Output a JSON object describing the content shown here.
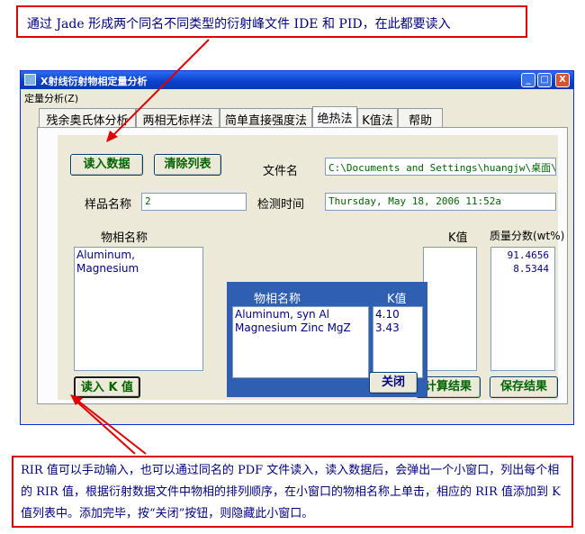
{
  "callout_top": "通过 Jade 形成两个同名不同类型的衍射峰文件 IDE 和 PID，在此都要读入",
  "callout_bottom": "RIR 值可以手动输入，也可以通过同名的 PDF 文件读入，读入数据后，会弹出一个小窗口，列出每个相的 RIR 值，根据衍射数据文件中物相的排列顺序，在小窗口的物相名称上单击，相应的 RIR 值添加到 K 值列表中。添加完毕，按“关闭”按钮，则隐藏此小窗口。",
  "window": {
    "title": "X射线衍射物相定量分析",
    "menu": [
      "定量分析(Z)"
    ],
    "controls": {
      "minimize": "_",
      "maximize": "□",
      "close": "X"
    }
  },
  "tabs": [
    "残余奥氏体分析",
    "两相无标样法",
    "简单直接强度法",
    "绝热法",
    "K值法",
    "帮助"
  ],
  "active_tab": "绝热法",
  "panel": {
    "read_data_button": "读入数据",
    "clear_list_button": "清除列表",
    "filename_label": "文件名",
    "filename_value": "C:\\Documents and Settings\\huangjw\\桌面\\:",
    "sample_name_label": "样品名称",
    "sample_name_value": "2",
    "detect_time_label": "检测时间",
    "detect_time_value": "Thursday, May 18, 2006 11:52a",
    "phase_name_header": "物相名称",
    "phase_list": [
      "Aluminum,",
      "Magnesium"
    ],
    "k_header": "K值",
    "mass_fraction_header": "质量分数(wt%)",
    "mass_fraction_values": [
      "91.4656",
      "8.5344"
    ],
    "read_k_button": "读入 K 值",
    "calc_button": "计算结果",
    "save_button": "保存结果"
  },
  "popup": {
    "phase_header": "物相名称",
    "k_header": "K值",
    "phases": [
      "Aluminum, syn     Al",
      "Magnesium Zinc     MgZ"
    ],
    "k_values": [
      "4.10",
      "3.43"
    ],
    "close_button": "关闭"
  }
}
